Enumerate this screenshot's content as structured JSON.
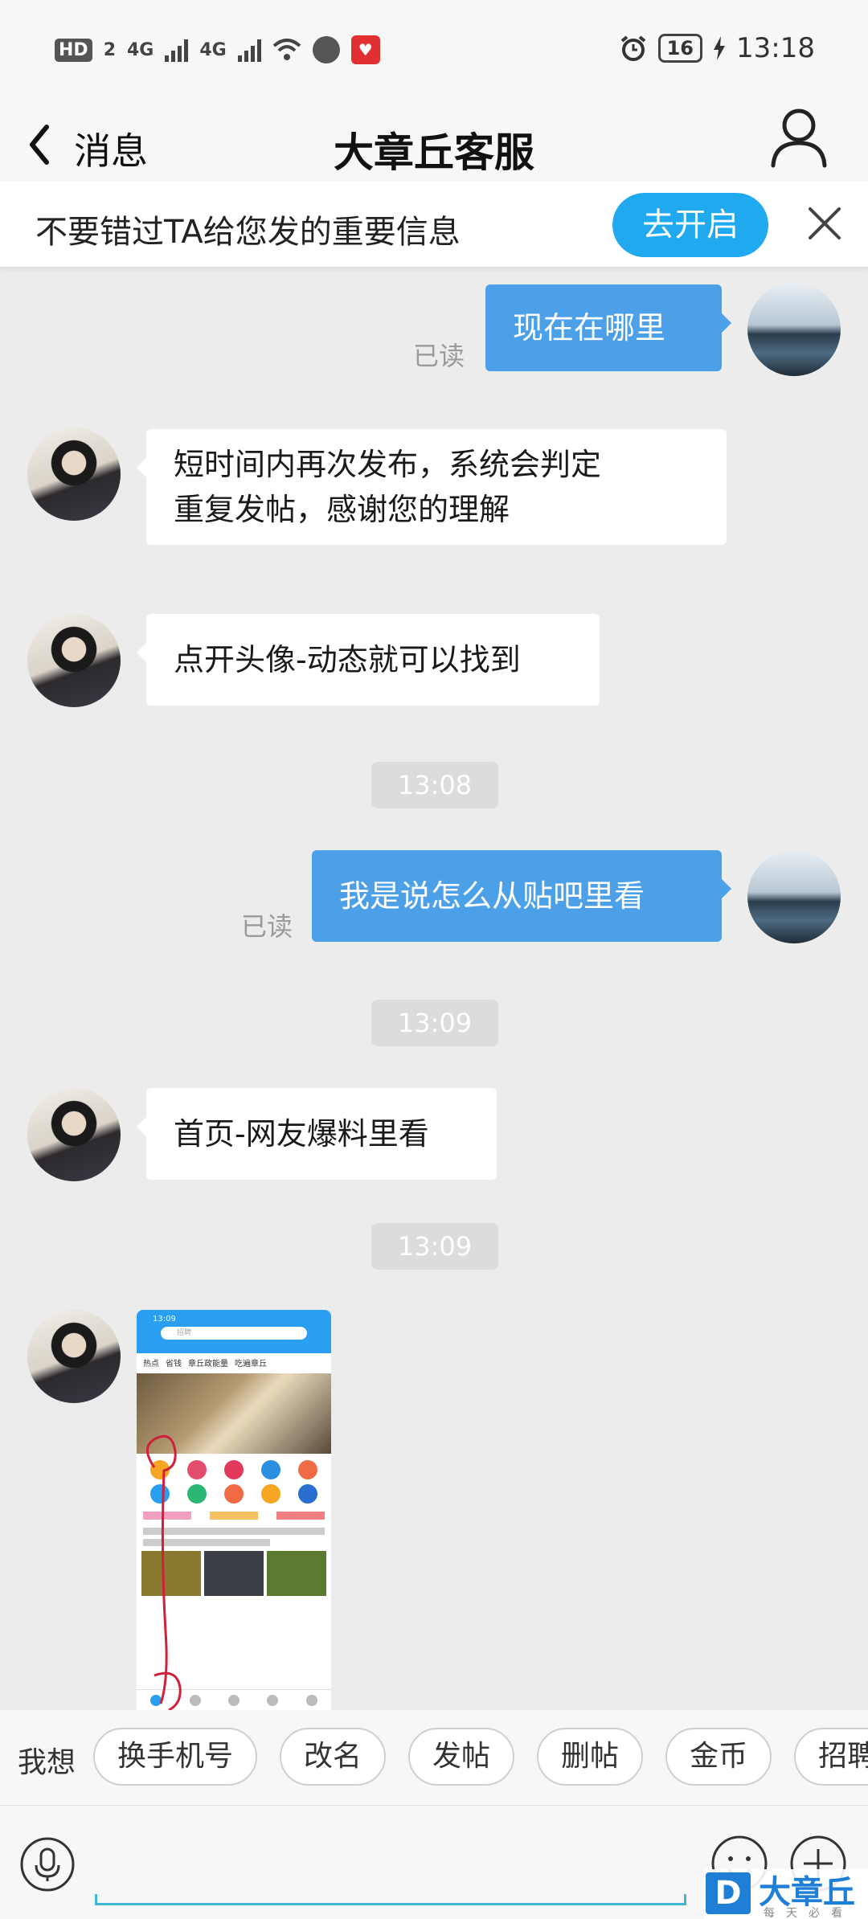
{
  "status_bar": {
    "network": "HD",
    "sim": "2",
    "signal1": "4G",
    "signal2": "4G",
    "battery": "16",
    "time": "13:18",
    "app_badge": "♥"
  },
  "header": {
    "back_label": "消息",
    "title": "大章丘客服"
  },
  "notice": {
    "text": "不要错过TA给您发的重要信息",
    "button": "去开启"
  },
  "messages": {
    "m1": {
      "text": "现在在哪里",
      "read": "已读"
    },
    "m2": {
      "line1": "短时间内再次发布，系统会判定",
      "line2": "重复发帖，感谢您的理解"
    },
    "m3": {
      "text": "点开头像-动态就可以找到"
    },
    "t1": "13:08",
    "m4": {
      "text": "我是说怎么从贴吧里看",
      "read": "已读"
    },
    "t2": "13:09",
    "m5": {
      "text": "首页-网友爆料里看"
    },
    "t3": "13:09"
  },
  "thumbnail": {
    "time": "13:09",
    "search": "招聘",
    "tabs": [
      "热点",
      "省钱",
      "章丘政能量",
      "吃遍章丘"
    ]
  },
  "quick_replies": {
    "label": "我想",
    "chips": [
      "换手机号",
      "改名",
      "发帖",
      "删帖",
      "金币",
      "招聘"
    ]
  },
  "watermark": {
    "logo": "D",
    "name": "大章丘",
    "slogan": "每天必看"
  }
}
